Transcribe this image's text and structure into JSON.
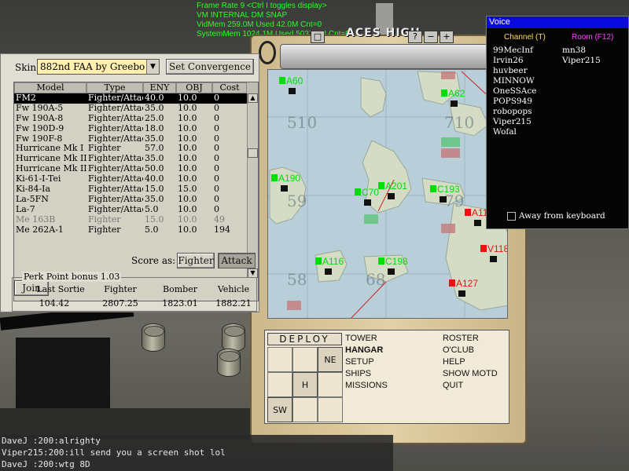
{
  "hud": {
    "line1": "Frame Rate    9 <Ctrl I toggles display>",
    "line2": "VM INTERNAL     DM SNAP",
    "line3": "VidMem 259.0M Used 42.0M Cnt=0",
    "line4": "SystemMem 1024.1M Used 5037.0M Cnt=0"
  },
  "logo": "ACES HIGH",
  "topbar": {
    "btn1": "□",
    "btn2": "?",
    "btn3": "−",
    "btn4": "+"
  },
  "hangar": {
    "skin_label": "Skin:",
    "skin_value": "882nd FAA by Greebo",
    "convergence_button": "Set Convergence",
    "columns": {
      "model": "Model",
      "type": "Type",
      "eny": "ENY",
      "obj": "OBJ",
      "cost": "Cost"
    },
    "planes": [
      {
        "model": "FM2",
        "type": "Fighter/Attack",
        "eny": "40.0",
        "obj": "10.0",
        "cost": "0",
        "state": "sel"
      },
      {
        "model": "Fw 190A-5",
        "type": "Fighter/Attack",
        "eny": "35.0",
        "obj": "10.0",
        "cost": "0",
        "state": ""
      },
      {
        "model": "Fw 190A-8",
        "type": "Fighter/Attack",
        "eny": "25.0",
        "obj": "10.0",
        "cost": "0",
        "state": ""
      },
      {
        "model": "Fw 190D-9",
        "type": "Fighter/Attack",
        "eny": "18.0",
        "obj": "10.0",
        "cost": "0",
        "state": ""
      },
      {
        "model": "Fw 190F-8",
        "type": "Fighter/Attack",
        "eny": "35.0",
        "obj": "10.0",
        "cost": "0",
        "state": ""
      },
      {
        "model": "Hurricane Mk I",
        "type": "Fighter",
        "eny": "57.0",
        "obj": "10.0",
        "cost": "0",
        "state": ""
      },
      {
        "model": "Hurricane Mk IIC",
        "type": "Fighter/Attack",
        "eny": "35.0",
        "obj": "10.0",
        "cost": "0",
        "state": ""
      },
      {
        "model": "Hurricane Mk IID",
        "type": "Fighter/Attack",
        "eny": "50.0",
        "obj": "10.0",
        "cost": "0",
        "state": ""
      },
      {
        "model": "Ki-61-I-Tei",
        "type": "Fighter/Attack",
        "eny": "40.0",
        "obj": "10.0",
        "cost": "0",
        "state": ""
      },
      {
        "model": "Ki-84-Ia",
        "type": "Fighter/Attack",
        "eny": "15.0",
        "obj": "15.0",
        "cost": "0",
        "state": ""
      },
      {
        "model": "La-5FN",
        "type": "Fighter/Attack",
        "eny": "35.0",
        "obj": "10.0",
        "cost": "0",
        "state": ""
      },
      {
        "model": "La-7",
        "type": "Fighter/Attack",
        "eny": "5.0",
        "obj": "10.0",
        "cost": "0",
        "state": ""
      },
      {
        "model": "Me 163B",
        "type": "Fighter",
        "eny": "15.0",
        "obj": "10.0",
        "cost": "49",
        "state": "dis"
      },
      {
        "model": "Me 262A-1",
        "type": "Fighter",
        "eny": "5.0",
        "obj": "10.0",
        "cost": "194",
        "state": ""
      }
    ],
    "join_button": "Join",
    "score_as_label": "Score as:",
    "fighter_button": "Fighter",
    "attack_button": "Attack",
    "perk_title": "Perk Point bonus 1.03",
    "perk_headers": {
      "last": "Last Sortie",
      "fighter": "Fighter",
      "bomber": "Bomber",
      "vehicle": "Vehicle"
    },
    "perk_values": {
      "last": "104.42",
      "fighter": "2807.25",
      "bomber": "1823.01",
      "vehicle": "1882.21"
    }
  },
  "map": {
    "sectors": [
      "510",
      "59",
      "68",
      "58",
      "710",
      "79"
    ],
    "bases": [
      {
        "label": "A60",
        "color": "#00dd00"
      },
      {
        "label": "A62",
        "color": "#00dd00"
      },
      {
        "label": "A190",
        "color": "#00dd00"
      },
      {
        "label": "C70",
        "color": "#00dd00"
      },
      {
        "label": "A201",
        "color": "#00dd00"
      },
      {
        "label": "C193",
        "color": "#00dd00"
      },
      {
        "label": "A117",
        "color": "#ee1111"
      },
      {
        "label": "V118",
        "color": "#ee1111"
      },
      {
        "label": "A116",
        "color": "#00dd00"
      },
      {
        "label": "C198",
        "color": "#00dd00"
      },
      {
        "label": "A127",
        "color": "#ee1111"
      }
    ]
  },
  "deploy": {
    "title": "DEPLOY",
    "ne": "NE",
    "h": "H",
    "sw": "SW",
    "menu": {
      "tower": "TOWER",
      "roster": "ROSTER",
      "hangar": "HANGAR",
      "oclub": "O'CLUB",
      "setup": "SETUP",
      "help": "HELP",
      "ships": "SHIPS",
      "show_motd": "SHOW MOTD",
      "missions": "MISSIONS",
      "quit": "QUIT"
    }
  },
  "voice": {
    "title": "Voice",
    "channel_header": "Channel (T)",
    "room_header": "Room (F12)",
    "channel": [
      "99MecInf",
      "Irvin26",
      "huvbeer",
      "MINNOW",
      "OneSSAce",
      "POPS949",
      "robopops",
      "Viper215",
      "Wofal"
    ],
    "room": [
      "mn38",
      "Viper215"
    ],
    "away_label": "Away from keyboard"
  },
  "chat": [
    "DaveJ :200:alrighty",
    "Viper215:200:ill send you a screen shot lol",
    "DaveJ :200:wtg 8D"
  ],
  "colors": {
    "friendly": "#00dd00",
    "enemy": "#ee1111",
    "hud": "#25ff25",
    "voice_title": "#0a0adf"
  }
}
